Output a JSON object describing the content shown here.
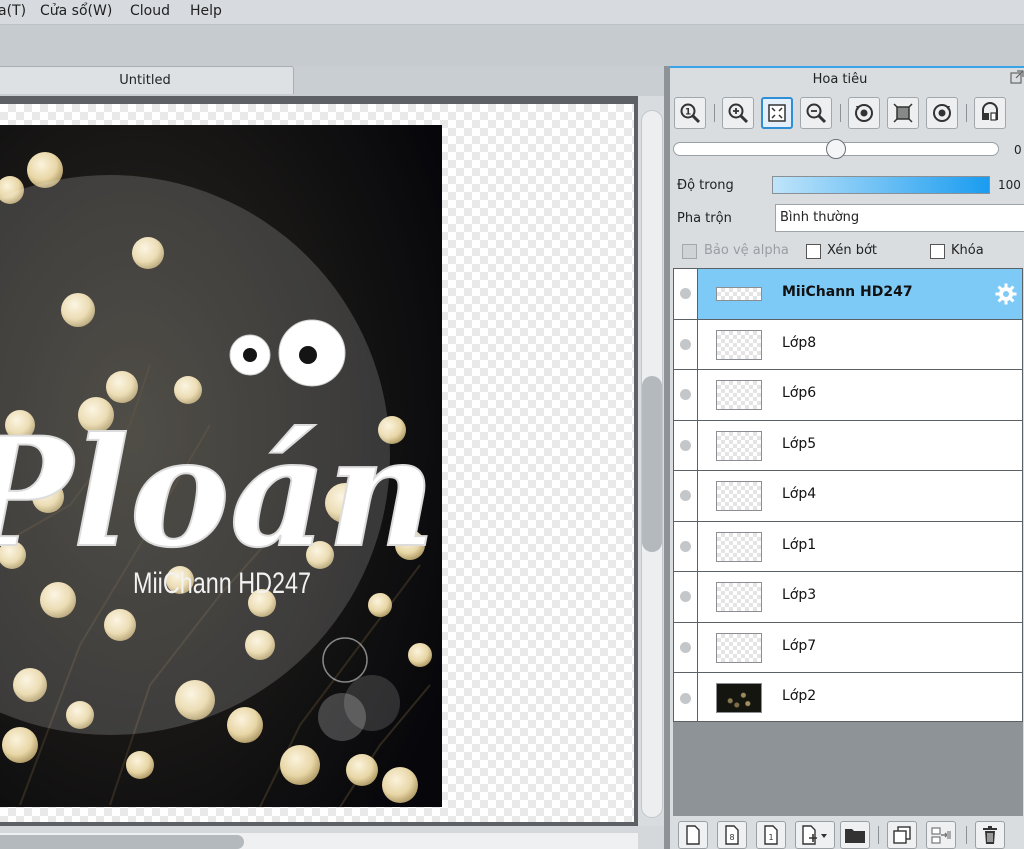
{
  "menu": {
    "items": [
      "a(T)",
      "Cửa sổ(W)",
      "Cloud",
      "Help"
    ]
  },
  "document": {
    "tab_title": "Untitled"
  },
  "artwork": {
    "title_text": "Ploán",
    "watermark_text": "MiiChann HD247"
  },
  "navigator": {
    "title": "Hoa tiêu",
    "zoom_value": "0",
    "tools": [
      "zoom-actual-icon",
      "zoom-in-icon",
      "fit-screen-icon",
      "zoom-out-icon",
      "rotate-left-icon",
      "fit-canvas-icon",
      "rotate-right-icon",
      "flip-icon"
    ]
  },
  "layer_props": {
    "opacity_label": "Độ trong",
    "opacity_value": "100",
    "opacity_level_percent": 100,
    "blend_label": "Pha trộn",
    "blend_value": "Bình thường",
    "protect_alpha_label": "Bảo vệ alpha",
    "clip_label": "Xén bớt",
    "lock_label": "Khóa"
  },
  "layers": [
    {
      "name": "MiiChann HD247",
      "selected": true,
      "thumb": "text"
    },
    {
      "name": "Lớp8",
      "selected": false,
      "thumb": "empty"
    },
    {
      "name": "Lớp6",
      "selected": false,
      "thumb": "empty"
    },
    {
      "name": "Lớp5",
      "selected": false,
      "thumb": "empty"
    },
    {
      "name": "Lớp4",
      "selected": false,
      "thumb": "empty"
    },
    {
      "name": "Lớp1",
      "selected": false,
      "thumb": "empty"
    },
    {
      "name": "Lớp3",
      "selected": false,
      "thumb": "empty"
    },
    {
      "name": "Lớp7",
      "selected": false,
      "thumb": "empty"
    },
    {
      "name": "Lớp2",
      "selected": false,
      "thumb": "photo"
    }
  ],
  "footer_tools": [
    "new-layer-icon",
    "new-8bit-layer-icon",
    "new-1bit-layer-icon",
    "add-layer-dropdown-icon",
    "new-folder-icon",
    "duplicate-layer-icon",
    "merge-down-icon",
    "delete-layer-icon"
  ],
  "colors": {
    "accent": "#3aa3e8",
    "selected_layer": "#7dcaf6",
    "panel_bg": "#d9dde0"
  }
}
